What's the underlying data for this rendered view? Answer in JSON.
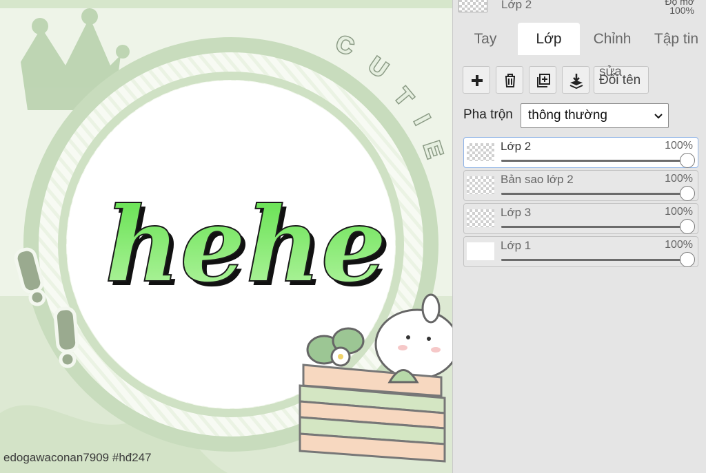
{
  "canvas": {
    "artwork_text": "hehe",
    "badge_text": "CUTIE",
    "credit": "edogawaconan7909   #hđ247",
    "colors": {
      "background": "#e9f2e1",
      "ring": "#c9dcc0",
      "text_green": "#7ee86a",
      "text_shadow": "#1a1a1a"
    }
  },
  "panel": {
    "top_layer": {
      "name": "Lớp 2",
      "opacity_label": "Độ mờ",
      "opacity": "100%"
    },
    "tabs": [
      {
        "label": "Tay",
        "active": false
      },
      {
        "label": "Lớp",
        "active": true
      },
      {
        "label": "Chỉnh sửa",
        "active": false
      },
      {
        "label": "Tập tin",
        "active": false
      }
    ],
    "toolbar": {
      "add_icon": "plus-icon",
      "delete_icon": "trash-icon",
      "duplicate_icon": "duplicate-icon",
      "merge_icon": "merge-down-icon",
      "rename_label_line1": "sửa",
      "rename_label_line2": "Đổi tên"
    },
    "blend": {
      "label": "Pha trộn",
      "value": "thông thường"
    },
    "layers": [
      {
        "name": "Lớp 2",
        "opacity": "100%",
        "value": 1.0,
        "selected": true,
        "thumb": "transparent"
      },
      {
        "name": "Bản sao lớp 2",
        "opacity": "100%",
        "value": 1.0,
        "selected": false,
        "thumb": "transparent"
      },
      {
        "name": "Lớp 3",
        "opacity": "100%",
        "value": 1.0,
        "selected": false,
        "thumb": "transparent"
      },
      {
        "name": "Lớp 1",
        "opacity": "100%",
        "value": 1.0,
        "selected": false,
        "thumb": "solid"
      }
    ]
  }
}
